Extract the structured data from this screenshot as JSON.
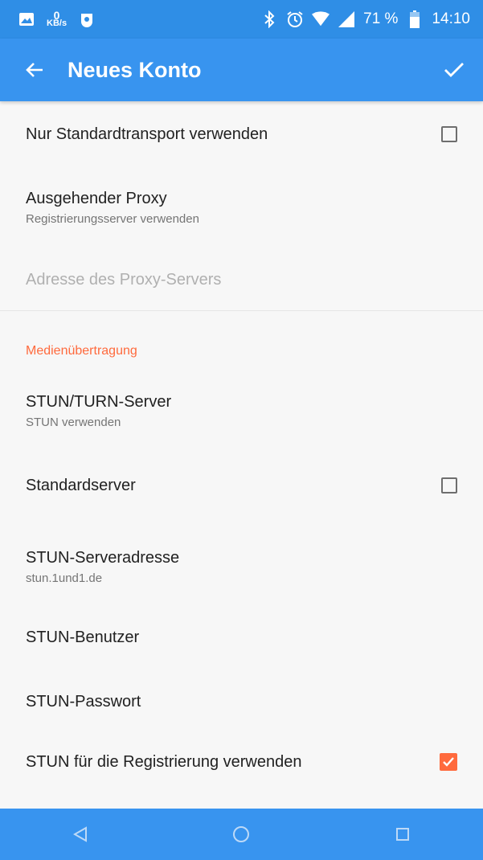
{
  "status_bar": {
    "kbs_value": "0",
    "kbs_unit": "KB/s",
    "battery": "71 %",
    "time": "14:10",
    "icons": [
      "image-icon",
      "kbs-indicator",
      "app-notification-icon",
      "bluetooth-icon",
      "alarm-icon",
      "wifi-icon",
      "signal-icon",
      "battery-icon"
    ]
  },
  "toolbar": {
    "title": "Neues Konto",
    "back_icon": "arrow-left-icon",
    "confirm_icon": "check-icon"
  },
  "prefs": {
    "default_transport": {
      "title": "Nur Standardtransport verwenden",
      "checked": false
    },
    "outbound_proxy": {
      "title": "Ausgehender Proxy",
      "summary": "Registrierungsserver verwenden"
    },
    "proxy_address": {
      "title": "Adresse des Proxy-Servers",
      "enabled": false
    }
  },
  "section": {
    "media_title": "Medienübertragung"
  },
  "media": {
    "stun_turn": {
      "title": "STUN/TURN-Server",
      "summary": "STUN verwenden"
    },
    "default_server": {
      "title": "Standardserver",
      "checked": false
    },
    "stun_address": {
      "title": "STUN-Serveradresse",
      "summary": "stun.1und1.de"
    },
    "stun_user": {
      "title": "STUN-Benutzer"
    },
    "stun_password": {
      "title": "STUN-Passwort"
    },
    "stun_registration": {
      "title": "STUN für die Registrierung verwenden",
      "checked": true
    }
  },
  "nav_bar": {
    "icons": [
      "nav-back-icon",
      "nav-home-icon",
      "nav-recents-icon"
    ]
  },
  "colors": {
    "status_bar": "#2f8ee6",
    "toolbar": "#3894ef",
    "accent": "#ff6a3d",
    "background": "#f7f7f7"
  }
}
